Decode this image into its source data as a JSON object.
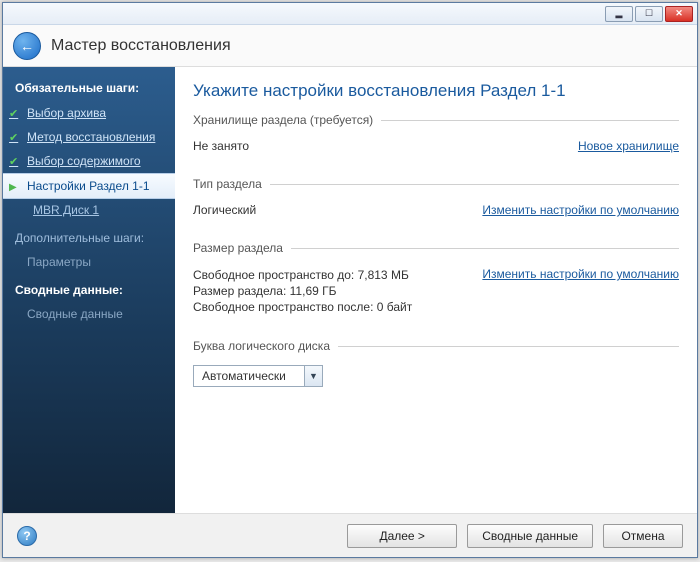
{
  "titlebar": {
    "minimize_glyph": "▂",
    "maximize_glyph": "☐",
    "close_glyph": "✕"
  },
  "header": {
    "back_glyph": "←",
    "title": "Мастер восстановления"
  },
  "sidebar": {
    "required_heading": "Обязательные шаги:",
    "steps": [
      "Выбор архива",
      "Метод восстановления",
      "Выбор содержимого",
      "Настройки Раздел 1-1"
    ],
    "subitem": "MBR Диск 1",
    "optional_heading": "Дополнительные шаги:",
    "optional_item": "Параметры",
    "summary_heading": "Сводные данные:",
    "summary_item": "Сводные данные"
  },
  "main": {
    "title": "Укажите настройки восстановления Раздел 1-1",
    "storage": {
      "label": "Хранилище раздела (требуется)",
      "value": "Не занято",
      "link": "Новое хранилище"
    },
    "ptype": {
      "label": "Тип раздела",
      "value": "Логический",
      "link": "Изменить настройки по умолчанию"
    },
    "psize": {
      "label": "Размер раздела",
      "free_before": "Свободное пространство до: 7,813 МБ",
      "size": "Размер раздела: 11,69 ГБ",
      "free_after": "Свободное пространство после: 0 байт",
      "link": "Изменить настройки по умолчанию"
    },
    "drive_letter": {
      "label": "Буква логического диска",
      "value": "Автоматически",
      "dropdown_glyph": "▼"
    }
  },
  "footer": {
    "help_glyph": "?",
    "next": "Далее >",
    "summary": "Сводные данные",
    "cancel": "Отмена"
  }
}
